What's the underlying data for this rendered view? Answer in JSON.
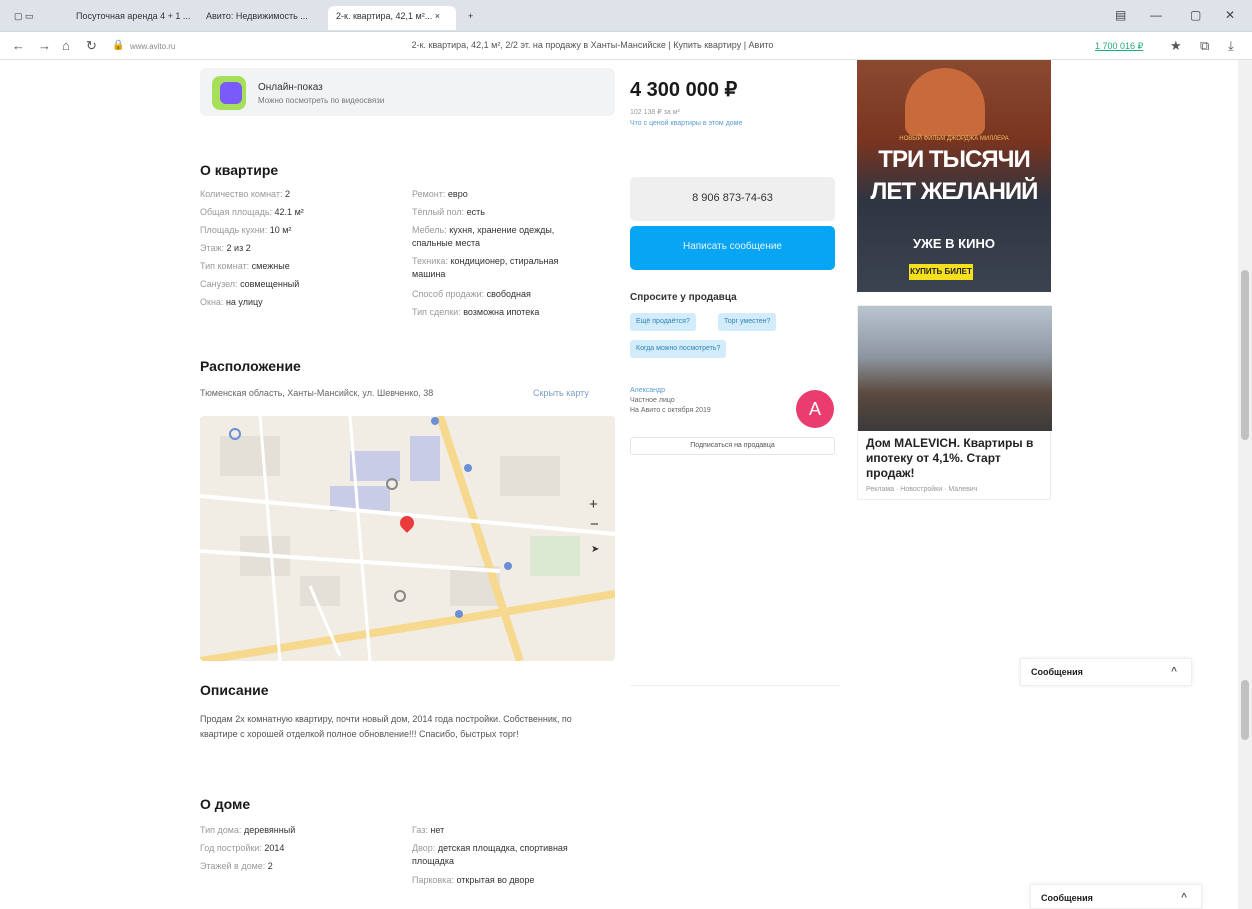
{
  "browser": {
    "tabs": [
      "Посуточная аренда 4 + 1 ...",
      "Авито: Недвижимость ...",
      "2-к. квартира, 42,1 м²... ×"
    ],
    "url_short": "www.avito.ru",
    "page_title": "2-к. квартира, 42,1 м², 2/2 эт. на продажу в Ханты-Мансийске | Купить квартиру | Авито",
    "ext_label": "1 700 016 ₽"
  },
  "online_tour": {
    "title": "Онлайн-показ",
    "subtitle": "Можно посмотреть по видеосвязи"
  },
  "about_flat": {
    "heading": "О квартире",
    "left": [
      {
        "k": "Количество комнат:",
        "v": "2"
      },
      {
        "k": "Общая площадь:",
        "v": "42.1 м²"
      },
      {
        "k": "Площадь кухни:",
        "v": "10 м²"
      },
      {
        "k": "Этаж:",
        "v": "2 из 2"
      },
      {
        "k": "Тип комнат:",
        "v": "смежные"
      },
      {
        "k": "Санузел:",
        "v": "совмещенный"
      },
      {
        "k": "Окна:",
        "v": "на улицу"
      }
    ],
    "right": [
      {
        "k": "Ремонт:",
        "v": "евро"
      },
      {
        "k": "Тёплый пол:",
        "v": "есть"
      },
      {
        "k": "Мебель:",
        "v": "кухня, хранение одежды, спальные места"
      },
      {
        "k": "Техника:",
        "v": "кондиционер, стиральная машина"
      },
      {
        "k": "Способ продажи:",
        "v": "свободная"
      },
      {
        "k": "Тип сделки:",
        "v": "возможна ипотека"
      }
    ]
  },
  "location": {
    "heading": "Расположение",
    "address": "Тюменская область, Ханты-Мансийск, ул. Шевченко, 38",
    "show_map": "Скрыть карту"
  },
  "description": {
    "heading": "Описание",
    "text": "Продам 2х комнатную квартиру, почти новый дом, 2014 года постройки. Собственник, по квартире с хорошей отделкой полное обновление!!! Спасибо, быстрых торг!"
  },
  "about_house": {
    "heading": "О доме",
    "left": [
      {
        "k": "Тип дома:",
        "v": "деревянный"
      },
      {
        "k": "Год постройки:",
        "v": "2014"
      },
      {
        "k": "Этажей в доме:",
        "v": "2"
      }
    ],
    "right": [
      {
        "k": "Газ:",
        "v": "нет"
      },
      {
        "k": "Двор:",
        "v": "детская площадка, спортивная площадка"
      },
      {
        "k": "Парковка:",
        "v": "открытая во дворе"
      }
    ]
  },
  "sidebar": {
    "price": "4 300 000 ₽",
    "price_per_m": "102 138 ₽ за м²",
    "price_link": "Что с ценой квартиры в этом доме",
    "phone": "8 906 873-74-63",
    "write": "Написать сообщение",
    "ask_heading": "Спросите у продавца",
    "chips": [
      "Ещё продаётся?",
      "Торг уместен?",
      "Когда можно посмотреть?"
    ],
    "seller_name": "Александр",
    "seller_type": "Частное лицо",
    "seller_since": "На Авито с октября 2019",
    "avatar_letter": "А",
    "subscribe": "Подписаться на продавца"
  },
  "ads": {
    "ad1_top": "НОВЫЙ ФИЛЬМ ДЖОРДЖА МИЛЛЕРА",
    "ad1_line1": "ТРИ ТЫСЯЧИ",
    "ad1_line2": "ЛЕТ ЖЕЛАНИЙ",
    "ad1_line3": "УЖЕ В КИНО",
    "ad1_button": "КУПИТЬ БИЛЕТ",
    "ad2_title": "Дом MALEVICH. Квартиры в ипотеку от 4,1%. Старт продаж!",
    "ad2_sub": "Реклама · Новостройки · Малевич"
  },
  "messages_label": "Сообщения"
}
